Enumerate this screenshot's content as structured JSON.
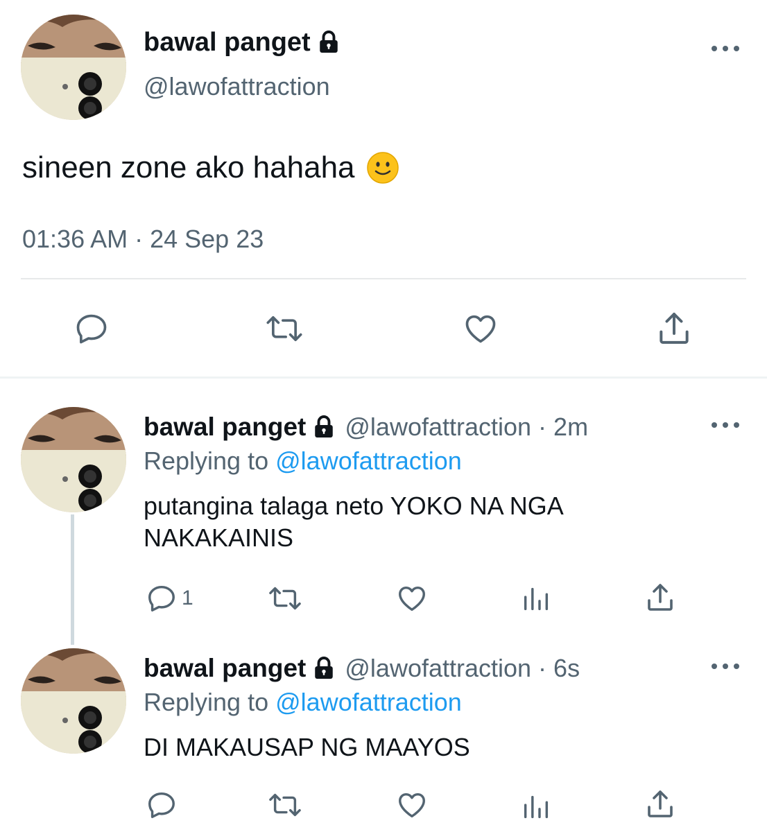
{
  "main_tweet": {
    "display_name": "bawal panget",
    "handle": "@lawofattraction",
    "text": "sineen zone ako hahaha",
    "emoji": "slightly-smiling-face",
    "timestamp": "01:36 AM · 24 Sep 23",
    "actions": [
      "reply-icon",
      "retweet-icon",
      "like-icon",
      "share-icon"
    ]
  },
  "replies": [
    {
      "display_name": "bawal panget",
      "meta": "@lawofattraction · 2m",
      "replying_prefix": "Replying to",
      "replying_handle": "@lawofattraction",
      "text": "putangina talaga neto YOKO NA NGA NAKAKAINIS",
      "reply_count": "1"
    },
    {
      "display_name": "bawal panget",
      "meta": "@lawofattraction · 6s",
      "replying_prefix": "Replying to",
      "replying_handle": "@lawofattraction",
      "text": "DI MAKAUSAP NG MAAYOS",
      "reply_count": ""
    }
  ],
  "colors": {
    "text": "#0f1419",
    "secondary": "#536471",
    "link": "#1d9bf0",
    "divider": "#e7e9ea"
  }
}
